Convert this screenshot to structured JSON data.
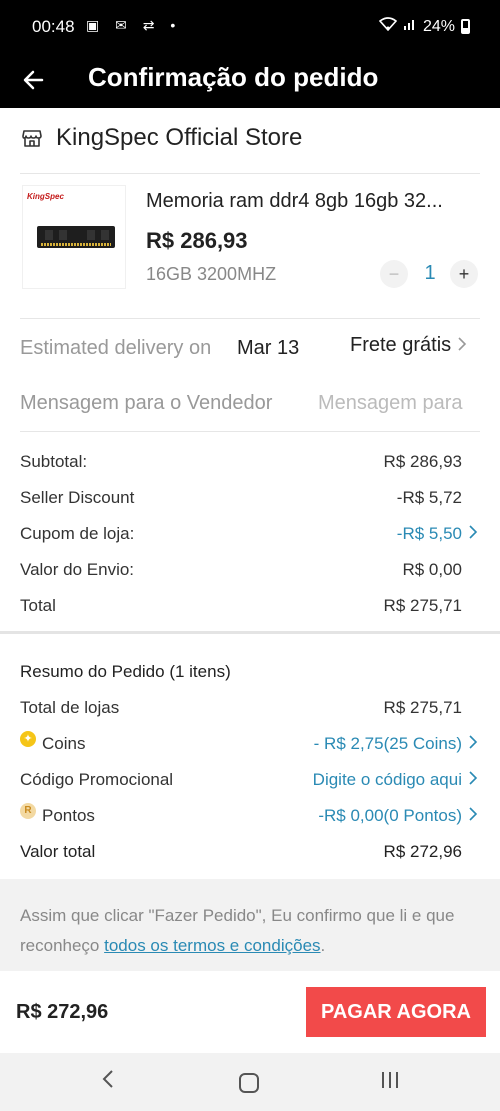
{
  "status_bar": {
    "time": "00:48",
    "notification_icons": "▣ ✉ ⇄ •",
    "battery": "24%",
    "signal": "📶"
  },
  "header": {
    "title": "Confirmação do pedido"
  },
  "store": {
    "name": "KingSpec Official Store"
  },
  "product": {
    "brand_logo": "KingSpec",
    "title": "Memoria ram ddr4 8gb 16gb 32...",
    "price": "R$ 286,93",
    "variant": "16GB 3200MHZ",
    "quantity": "1",
    "minus": "−",
    "plus": "+"
  },
  "delivery": {
    "label": "Estimated delivery on",
    "date": "Mar 13",
    "shipping": "Frete grátis"
  },
  "message": {
    "label": "Mensagem para o Vendedor",
    "placeholder": "Mensagem para"
  },
  "seller_summary": {
    "subtotal_label": "Subtotal:",
    "subtotal_value": "R$ 286,93",
    "discount_label": "Seller Discount",
    "discount_value": "-R$ 5,72",
    "coupon_label": "Cupom de loja:",
    "coupon_value": "-R$ 5,50",
    "shipping_label": "Valor do Envio:",
    "shipping_value": "R$ 0,00",
    "total_label": "Total",
    "total_value": "R$ 275,71"
  },
  "order_summary": {
    "title": "Resumo do Pedido (1 itens)",
    "stores_label": "Total de lojas",
    "stores_value": "R$ 275,71",
    "coins_label": "Coins",
    "coins_value": "- R$ 2,75(25 Coins)",
    "promo_label": "Código Promocional",
    "promo_value": "Digite o código aqui",
    "points_label": "Pontos",
    "points_value": "-R$ 0,00(0 Pontos)",
    "grand_label": "Valor total",
    "grand_value": "R$ 272,96"
  },
  "terms": {
    "text": "Assim que clicar \"Fazer Pedido\", Eu confirmo que li e que reconheço ",
    "link": "todos os termos e condições",
    "end": "."
  },
  "footer": {
    "total": "R$ 272,96",
    "pay_button": "PAGAR AGORA"
  },
  "colors": {
    "accent_blue": "#2a8ab4",
    "pay_red": "#f24a4a",
    "header_bg": "#000000"
  },
  "icons": [
    "back-arrow-icon",
    "store-icon",
    "chevron-right-icon",
    "coin-icon",
    "points-icon",
    "nav-back-icon",
    "nav-home-icon",
    "nav-recent-icon"
  ]
}
